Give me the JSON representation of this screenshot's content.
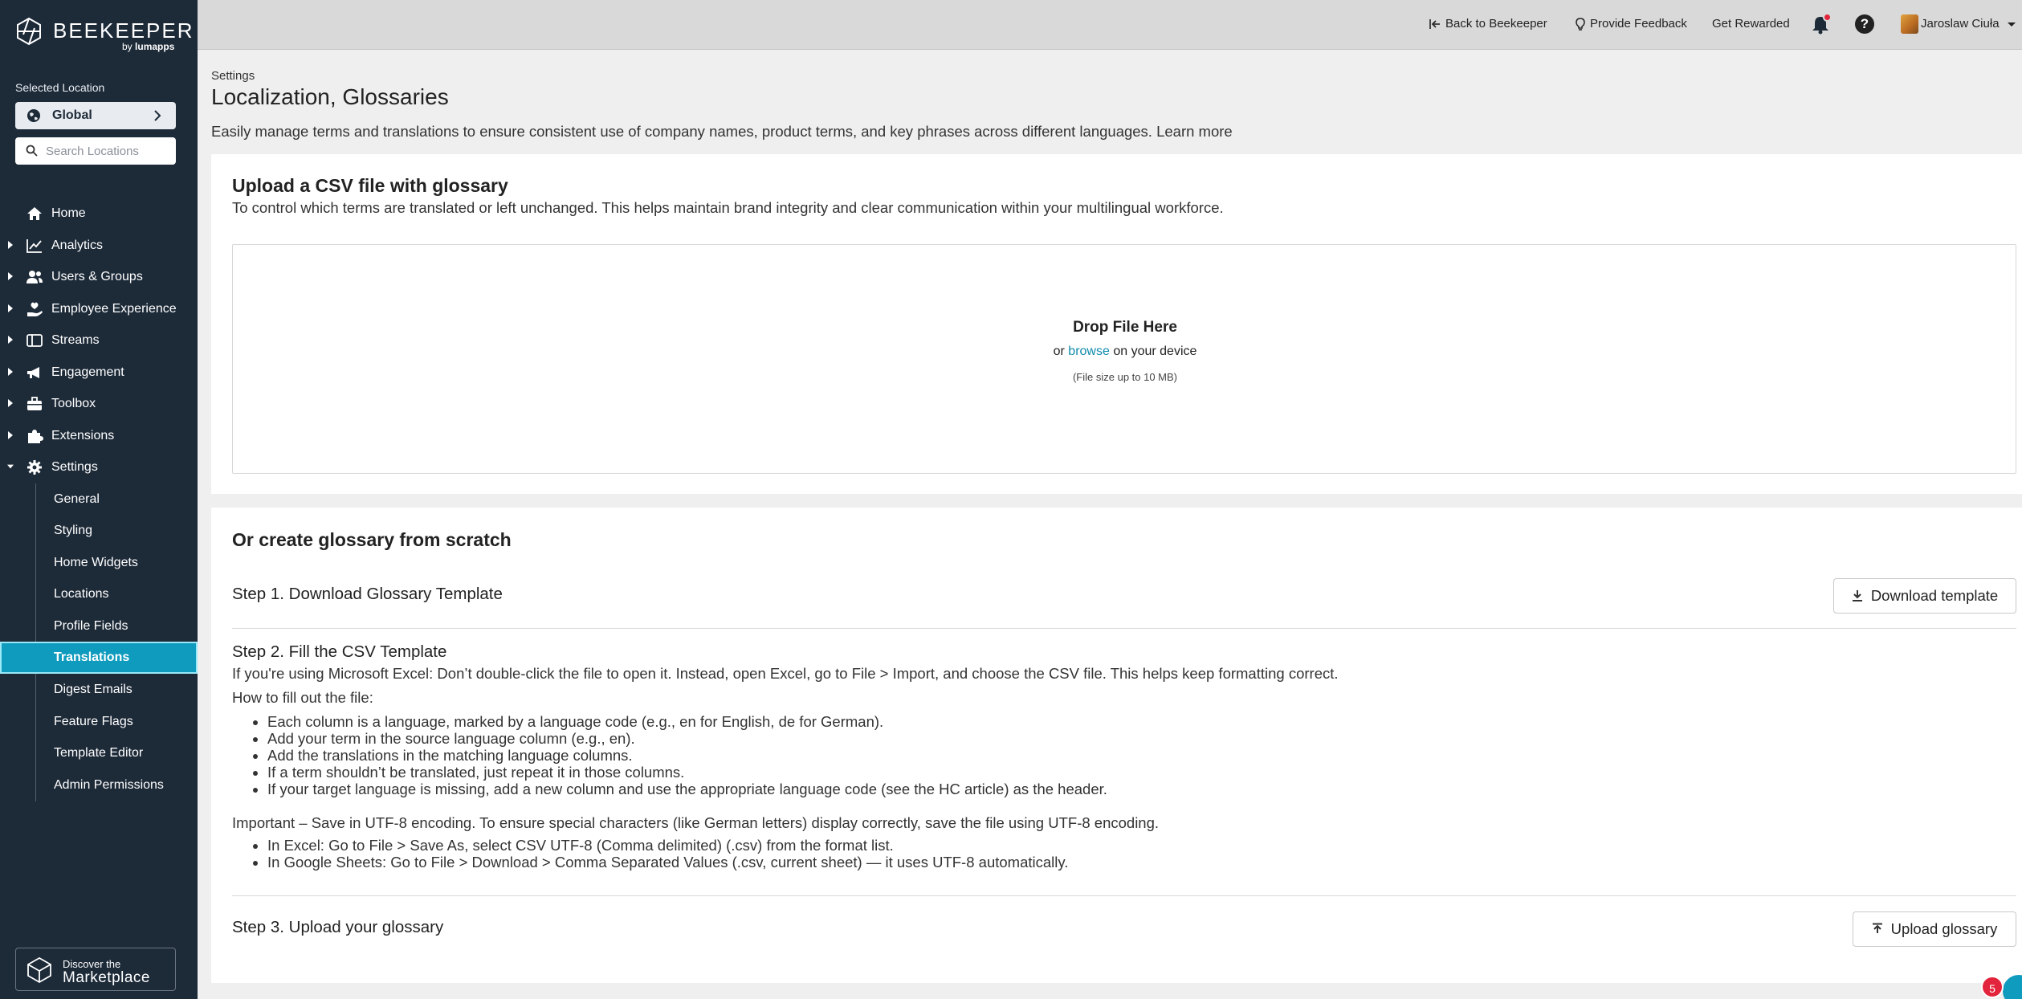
{
  "brand": {
    "name": "BEEKEEPER",
    "by": "by",
    "by_brand": "lumapps"
  },
  "sidebar": {
    "selected_location_label": "Selected Location",
    "location_name": "Global",
    "search_placeholder": "Search Locations",
    "items": [
      {
        "label": "Home",
        "icon": "home-icon"
      },
      {
        "label": "Analytics",
        "icon": "chart-icon"
      },
      {
        "label": "Users & Groups",
        "icon": "users-icon"
      },
      {
        "label": "Employee Experience",
        "icon": "hand-heart-icon"
      },
      {
        "label": "Streams",
        "icon": "streams-icon"
      },
      {
        "label": "Engagement",
        "icon": "megaphone-icon"
      },
      {
        "label": "Toolbox",
        "icon": "toolbox-icon"
      },
      {
        "label": "Extensions",
        "icon": "puzzle-icon"
      },
      {
        "label": "Settings",
        "icon": "gear-icon"
      }
    ],
    "settings_sub": [
      {
        "label": "General"
      },
      {
        "label": "Styling"
      },
      {
        "label": "Home Widgets"
      },
      {
        "label": "Locations"
      },
      {
        "label": "Profile Fields"
      },
      {
        "label": "Translations",
        "active": true
      },
      {
        "label": "Digest Emails"
      },
      {
        "label": "Feature Flags"
      },
      {
        "label": "Template Editor"
      },
      {
        "label": "Admin Permissions"
      }
    ],
    "marketplace_line1": "Discover the",
    "marketplace_line2": "Marketplace"
  },
  "topbar": {
    "back": "Back to Beekeeper",
    "feedback": "Provide Feedback",
    "rewarded": "Get Rewarded",
    "user": "Jaroslaw Ciuła"
  },
  "page": {
    "breadcrumb": "Settings",
    "title": "Localization, Glossaries",
    "description": "Easily manage terms and translations to ensure consistent use of company names, product terms, and key phrases across different languages. Learn more"
  },
  "upload_card": {
    "title": "Upload a CSV file with glossary",
    "description": "To control which terms are translated or left unchanged. This helps maintain brand integrity and clear communication within your multilingual workforce.",
    "drop_title": "Drop File Here",
    "drop_or": "or",
    "drop_browse": "browse",
    "drop_rest": "on your device",
    "drop_note": "(File size up to 10 MB)"
  },
  "scratch_card": {
    "title": "Or create glossary from scratch",
    "step1": "Step 1. Download Glossary Template",
    "download_btn": "Download template",
    "step2": "Step 2. Fill the CSV Template",
    "excel_note": "If you're using Microsoft Excel: Don’t double-click the file to open it. Instead, open Excel, go to File > Import, and choose the CSV file. This helps keep formatting correct.",
    "how_to": "How to fill out the file:",
    "bullets": [
      "Each column is a language, marked by a language code (e.g., en for English, de for German).",
      "Add your term in the source language column (e.g., en).",
      "Add the translations in the matching language columns.",
      "If a term shouldn’t be translated, just repeat it in those columns.",
      "If your target language is missing, add a new column and use the appropriate language code (see the HC article) as the header."
    ],
    "important": "Important – Save in UTF-8 encoding. To ensure special characters (like German letters) display correctly, save the file using UTF-8 encoding.",
    "encoding_bullets": [
      "In Excel: Go to File > Save As, select CSV UTF-8 (Comma delimited) (.csv) from the format list.",
      "In Google Sheets: Go to File > Download > Comma Separated Values (.csv, current sheet) — it uses UTF-8 automatically."
    ],
    "step3": "Step 3. Upload your glossary",
    "upload_btn": "Upload glossary"
  },
  "chat": {
    "unread": "5"
  }
}
